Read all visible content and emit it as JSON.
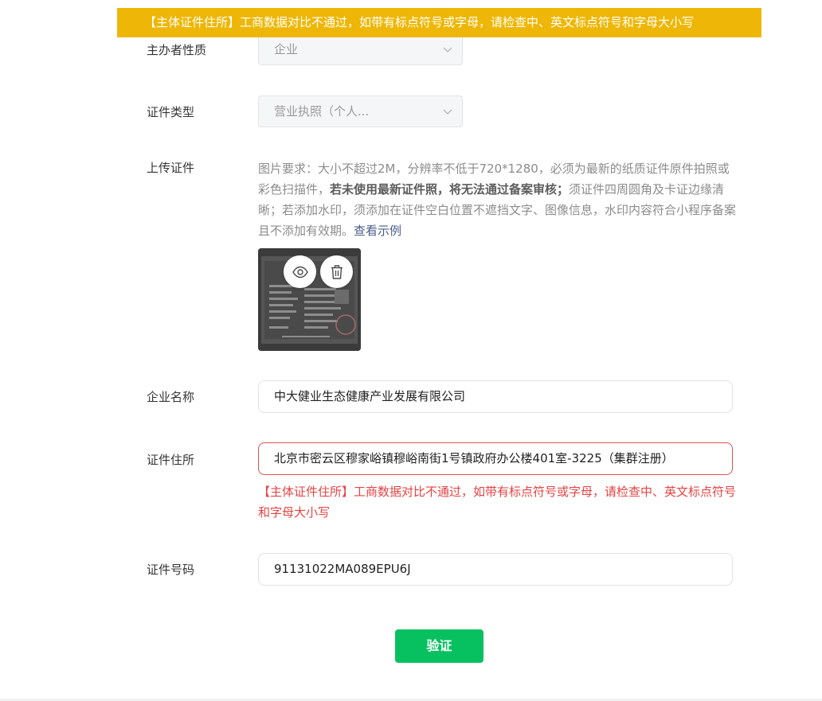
{
  "banner": {
    "message": "【主体证件住所】工商数据对比不通过，如带有标点符号或字母，请检查中、英文标点符号和字母大小写"
  },
  "form": {
    "organizer_nature": {
      "label": "主办者性质",
      "value": "企业"
    },
    "certificate_type": {
      "label": "证件类型",
      "value": "营业执照（个人..."
    },
    "upload": {
      "label": "上传证件",
      "requirement_part1": "图片要求：大小不超过2M，分辨率不低于720*1280，必须为最新的纸质证件原件拍照或彩色扫描件，",
      "requirement_bold": "若未使用最新证件照，将无法通过备案审核；",
      "requirement_part2": "须证件四周圆角及卡证边缘清晰；若添加水印，须添加在证件空白位置不遮挡文字、图像信息，水印内容符合小程序备案且不添加有效期。",
      "example_link": "查看示例",
      "preview_icon": "eye-icon",
      "delete_icon": "trash-icon"
    },
    "company_name": {
      "label": "企业名称",
      "value": "中大健业生态健康产业发展有限公司"
    },
    "certificate_address": {
      "label": "证件住所",
      "value": "北京市密云区穆家峪镇穆峪南街1号镇政府办公楼401室-3225（集群注册）",
      "error": "【主体证件住所】工商数据对比不通过，如带有标点符号或字母，请检查中、英文标点符号和字母大小写"
    },
    "certificate_number": {
      "label": "证件号码",
      "value": "91131022MA089EPU6J"
    }
  },
  "actions": {
    "verify_label": "验证"
  },
  "colors": {
    "banner": "#eeb707",
    "error": "#e64343",
    "primary": "#07c160",
    "link": "#4a5d8a"
  }
}
